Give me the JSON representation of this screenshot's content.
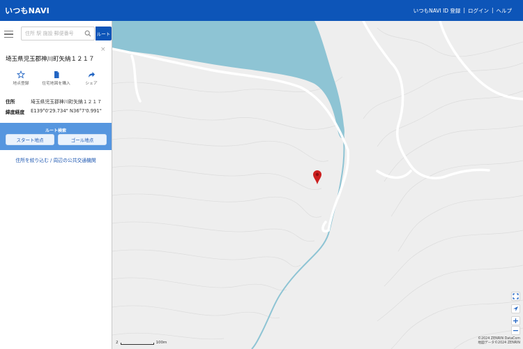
{
  "header": {
    "logo": "いつもNAVI",
    "links": [
      "いつもNAVI ID 登録",
      "ログイン",
      "ヘルプ"
    ]
  },
  "sidebar": {
    "search_placeholder": "住所 駅 施設 郵便番号",
    "route_button": "ルート",
    "close": "×",
    "place_title": "埼玉県児玉郡神川町矢納１２１７",
    "actions": [
      {
        "icon": "star-icon",
        "label": "地点登録"
      },
      {
        "icon": "document-icon",
        "label": "住宅地図を購入"
      },
      {
        "icon": "share-icon",
        "label": "シェア"
      }
    ],
    "info": {
      "address_label": "住所",
      "address_value": "埼玉県児玉郡神川町矢納１２１７",
      "coord_label": "緯度経度",
      "coord_value": "E139°0'29.734\" N36°7'0.991\""
    },
    "route_panel": {
      "title": "ルート検索",
      "start": "スタート地点",
      "goal": "ゴール地点"
    },
    "link": "住所を絞り込む / 周辺の公共交通機関"
  },
  "map": {
    "scale_label": "100m",
    "scale_prefix": "2",
    "copyright_line1": "©2024 ZENRIN DataCom",
    "copyright_line2": "地図データ©2024 ZENRIN",
    "colors": {
      "water": "#8ec4d4",
      "road": "#ffffff",
      "background": "#eeeeee",
      "marker": "#cc1f1f"
    }
  }
}
